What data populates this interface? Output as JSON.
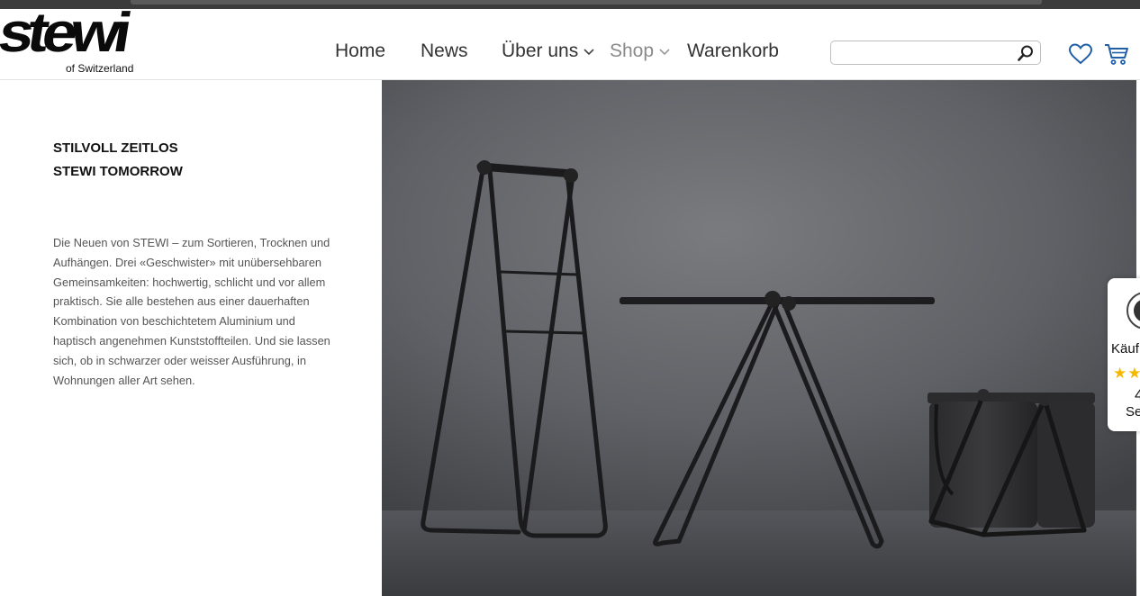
{
  "brand": {
    "logo_text": "stewi",
    "tagline": "of Switzerland"
  },
  "nav": {
    "items": [
      {
        "label": "Home"
      },
      {
        "label": "News"
      },
      {
        "label": "Über uns"
      },
      {
        "label": "Shop"
      },
      {
        "label": "Warenkorb"
      }
    ]
  },
  "search": {
    "value": "",
    "placeholder": ""
  },
  "icons": {
    "search": "search-icon",
    "wishlist": "heart-icon",
    "cart": "cart-icon",
    "dropdown": "chevron-down-icon"
  },
  "content": {
    "headline_1": "STILVOLL ZEITLOS",
    "headline_2": "STEWI TOMORROW",
    "body": "Die Neuen von STEWI – zum Sortieren, Trocknen und Aufhängen. Drei «Geschwister» mit unübersehbaren Gemeinsamkeiten: hochwertig, schlicht und vor allem praktisch. Sie alle bestehen aus einer dauerhaften Kombination von beschichtetem Aluminium und haptisch angenehmen Kunststoffteilen. Und sie lassen sich, ob in schwarzer oder weisser Ausführung, in Wohnungen aller Art sehen."
  },
  "trust_badge": {
    "label": "Käuf",
    "stars": "★★",
    "score": "4",
    "more": "Se"
  },
  "colors": {
    "accent_blue": "#1f5fa8",
    "star_yellow": "#f5b800",
    "muted_nav": "#8a8a8a",
    "hero_wall": "#5f6064"
  }
}
